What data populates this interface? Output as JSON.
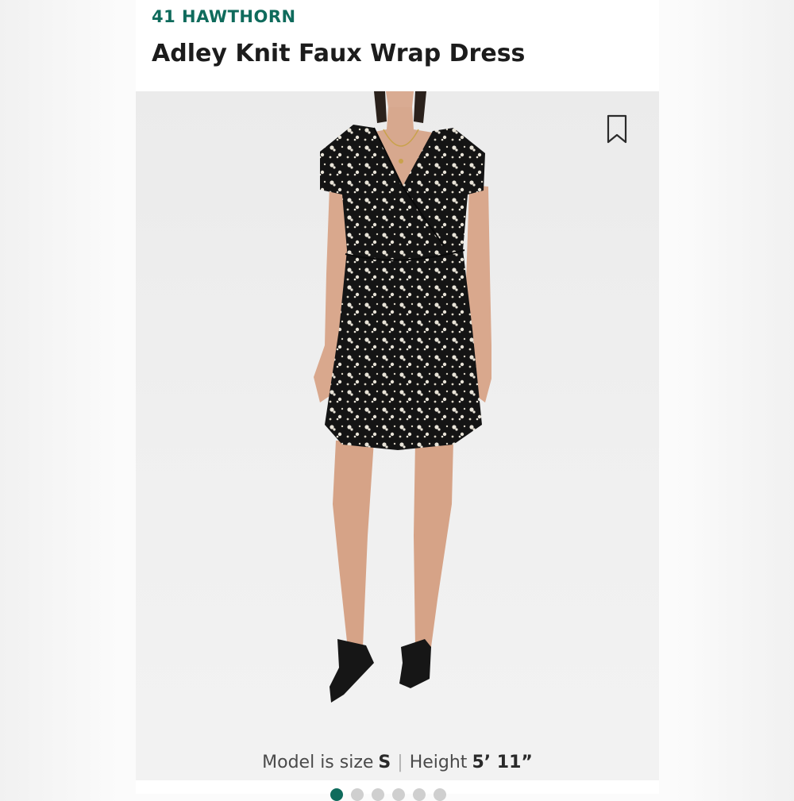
{
  "brand": "41 HAWTHORN",
  "product_title": "Adley Knit Faux Wrap Dress",
  "image": {
    "bookmark_icon": "bookmark-icon",
    "alt": "Model wearing black floral faux wrap dress"
  },
  "model_info": {
    "size_label": "Model is size",
    "size_value": "S",
    "separator": "|",
    "height_label": "Height",
    "height_value": "5’ 11”"
  },
  "carousel": {
    "dots": [
      "1",
      "2",
      "3",
      "4",
      "5",
      "6"
    ],
    "active_index": 0
  },
  "colors": {
    "brand": "#0f6b5c",
    "title": "#1c1c1c"
  }
}
